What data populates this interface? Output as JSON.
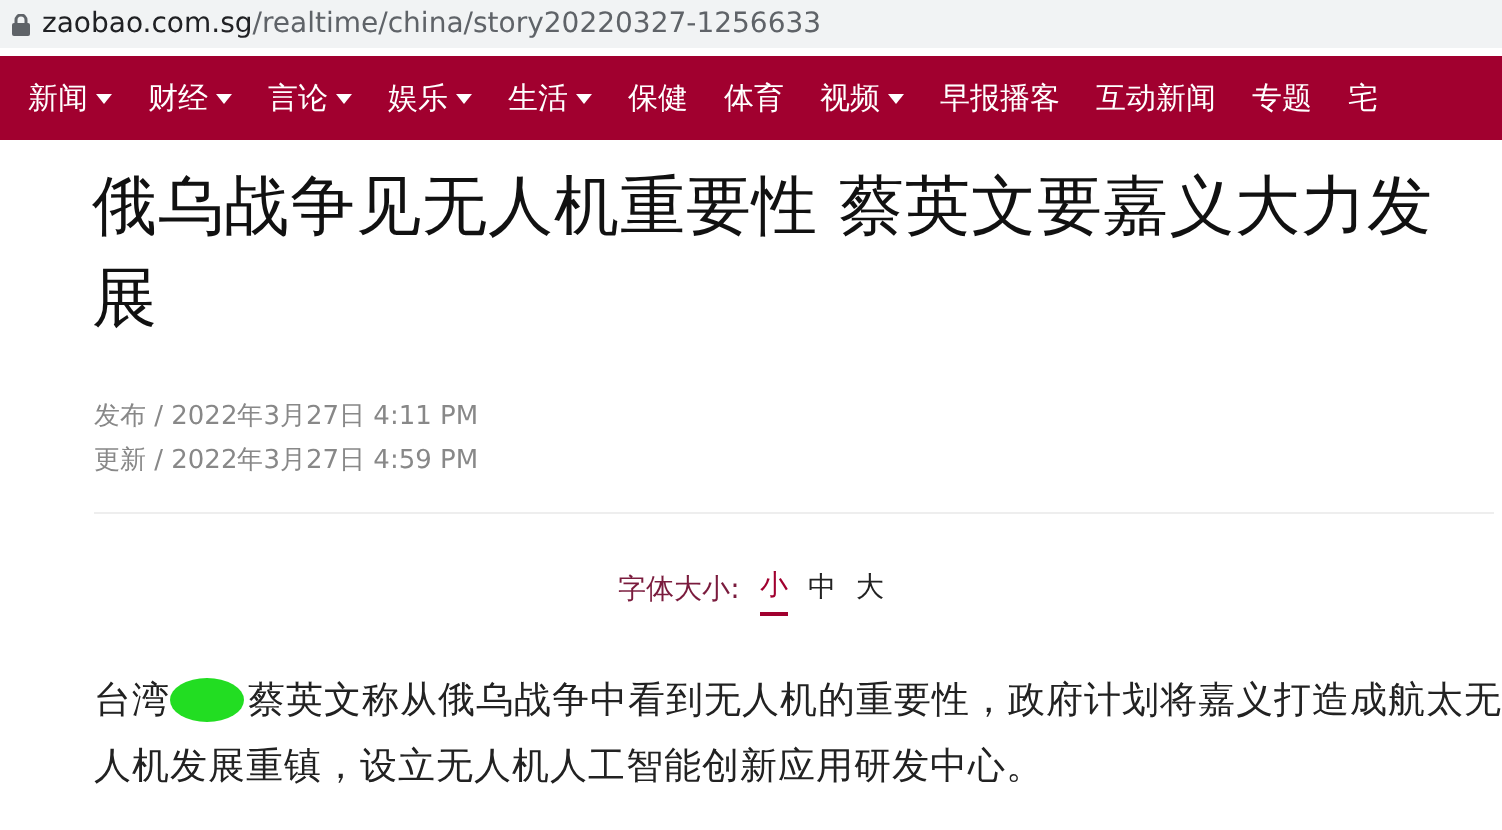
{
  "address_bar": {
    "url_host": "zaobao.com.sg",
    "url_path": "/realtime/china/story20220327-1256633"
  },
  "nav": {
    "items": [
      {
        "label": "新闻",
        "dropdown": true
      },
      {
        "label": "财经",
        "dropdown": true
      },
      {
        "label": "言论",
        "dropdown": true
      },
      {
        "label": "娱乐",
        "dropdown": true
      },
      {
        "label": "生活",
        "dropdown": true
      },
      {
        "label": "保健",
        "dropdown": false
      },
      {
        "label": "体育",
        "dropdown": false
      },
      {
        "label": "视频",
        "dropdown": true
      },
      {
        "label": "早报播客",
        "dropdown": false
      },
      {
        "label": "互动新闻",
        "dropdown": false
      },
      {
        "label": "专题",
        "dropdown": false
      },
      {
        "label": "宅",
        "dropdown": false
      }
    ]
  },
  "article": {
    "headline": "俄乌战争见无人机重要性 蔡英文要嘉义大力发展",
    "published": "发布 / 2022年3月27日 4:11 PM",
    "updated": "更新 / 2022年3月27日 4:59 PM",
    "font_size": {
      "label": "字体大小:",
      "options": [
        {
          "label": "小",
          "selected": true
        },
        {
          "label": "中",
          "selected": false
        },
        {
          "label": "大",
          "selected": false
        }
      ]
    },
    "paragraph": {
      "before_redaction": "台湾",
      "after_redaction": "蔡英文称从俄乌战争中看到无人机的重要性，政府计划将嘉义打造成航太无人机发展重镇，设立无人机人工智能创新应用研发中心。",
      "redacted": true
    }
  }
}
